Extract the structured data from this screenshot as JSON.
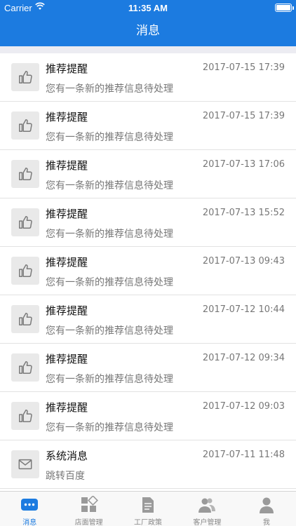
{
  "status_bar": {
    "carrier": "Carrier",
    "time": "11:35 AM"
  },
  "nav": {
    "title": "消息"
  },
  "messages": [
    {
      "title": "推荐提醒",
      "subtitle": "您有一条新的推荐信息待处理",
      "time": "2017-07-15 17:39",
      "icon": "thumbs-up-icon"
    },
    {
      "title": "推荐提醒",
      "subtitle": "您有一条新的推荐信息待处理",
      "time": "2017-07-15 17:39",
      "icon": "thumbs-up-icon"
    },
    {
      "title": "推荐提醒",
      "subtitle": "您有一条新的推荐信息待处理",
      "time": "2017-07-13 17:06",
      "icon": "thumbs-up-icon"
    },
    {
      "title": "推荐提醒",
      "subtitle": "您有一条新的推荐信息待处理",
      "time": "2017-07-13 15:52",
      "icon": "thumbs-up-icon"
    },
    {
      "title": "推荐提醒",
      "subtitle": "您有一条新的推荐信息待处理",
      "time": "2017-07-13 09:43",
      "icon": "thumbs-up-icon"
    },
    {
      "title": "推荐提醒",
      "subtitle": "您有一条新的推荐信息待处理",
      "time": "2017-07-12 10:44",
      "icon": "thumbs-up-icon"
    },
    {
      "title": "推荐提醒",
      "subtitle": "您有一条新的推荐信息待处理",
      "time": "2017-07-12 09:34",
      "icon": "thumbs-up-icon"
    },
    {
      "title": "推荐提醒",
      "subtitle": "您有一条新的推荐信息待处理",
      "time": "2017-07-12 09:03",
      "icon": "thumbs-up-icon"
    },
    {
      "title": "系统消息",
      "subtitle": "跳转百度",
      "time": "2017-07-11 11:48",
      "icon": "envelope-icon"
    }
  ],
  "tabs": [
    {
      "label": "消息",
      "icon": "chat-bubble-icon",
      "active": true
    },
    {
      "label": "店面管理",
      "icon": "grid-icon",
      "active": false
    },
    {
      "label": "工厂政策",
      "icon": "document-icon",
      "active": false
    },
    {
      "label": "客户管理",
      "icon": "people-icon",
      "active": false
    },
    {
      "label": "我",
      "icon": "person-icon",
      "active": false
    }
  ],
  "colors": {
    "accent": "#1c7be0",
    "tab_inactive": "#9a9a9a",
    "icon": "#7a7a7a"
  }
}
